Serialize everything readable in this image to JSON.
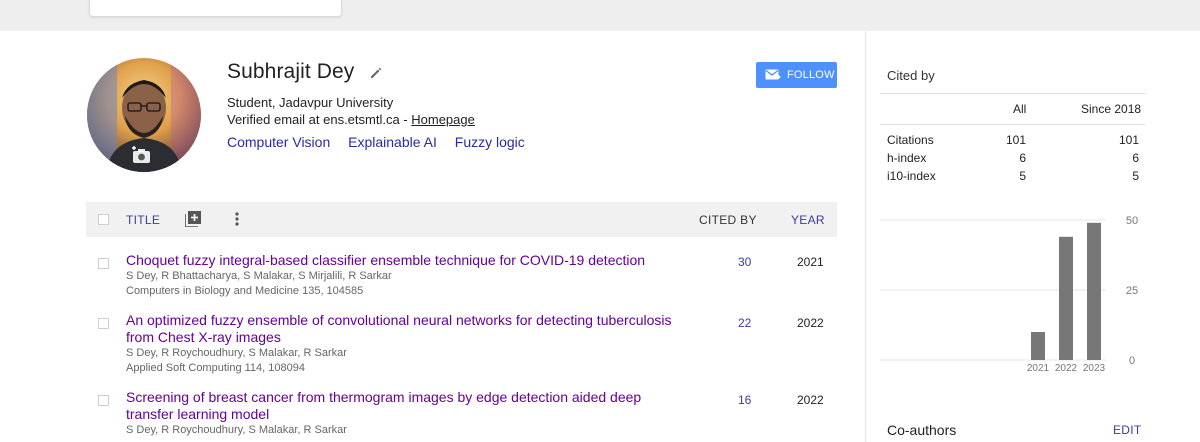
{
  "profile": {
    "name": "Subhrajit Dey",
    "affiliation": "Student, Jadavpur University",
    "email_text": "Verified email at ens.etsmtl.ca - ",
    "homepage_label": "Homepage",
    "interests": [
      "Computer Vision",
      "Explainable AI",
      "Fuzzy logic"
    ],
    "follow_label": "FOLLOW"
  },
  "table": {
    "col_title": "TITLE",
    "col_cited": "CITED BY",
    "col_year": "YEAR",
    "rows": [
      {
        "title": "Choquet fuzzy integral-based classifier ensemble technique for COVID-19 detection",
        "authors": "S Dey, R Bhattacharya, S Malakar, S Mirjalili, R Sarkar",
        "venue": "Computers in Biology and Medicine 135, 104585",
        "cited": "30",
        "year": "2021"
      },
      {
        "title": "An optimized fuzzy ensemble of convolutional neural networks for detecting tuberculosis from Chest X-ray images",
        "authors": "S Dey, R Roychoudhury, S Malakar, R Sarkar",
        "venue": "Applied Soft Computing 114, 108094",
        "cited": "22",
        "year": "2022"
      },
      {
        "title": "Screening of breast cancer from thermogram images by edge detection aided deep transfer learning model",
        "authors": "S Dey, R Roychoudhury, S Malakar, R Sarkar",
        "venue": "",
        "cited": "16",
        "year": "2022"
      }
    ]
  },
  "cited_by": {
    "heading": "Cited by",
    "col_all": "All",
    "col_since": "Since 2018",
    "stats": [
      {
        "label": "Citations",
        "all": "101",
        "since": "101"
      },
      {
        "label": "h-index",
        "all": "6",
        "since": "6"
      },
      {
        "label": "i10-index",
        "all": "5",
        "since": "5"
      }
    ]
  },
  "chart_data": {
    "type": "bar",
    "categories": [
      "2021",
      "2022",
      "2023"
    ],
    "values": [
      10,
      44,
      49
    ],
    "ylim": [
      0,
      50
    ],
    "yticks": [
      "50",
      "25",
      "0"
    ],
    "bar_color": "#777777"
  },
  "coauthors": {
    "heading": "Co-authors",
    "edit_label": "EDIT"
  },
  "colors": {
    "accent": "#4d90fe",
    "link_title": "#660099",
    "link_blue": "#3b3ba8"
  }
}
